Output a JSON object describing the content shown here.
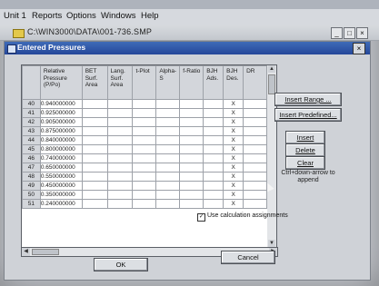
{
  "app": {
    "menu": [
      "Unit 1",
      "Reports",
      "Options",
      "Windows",
      "Help"
    ],
    "window_path": "C:\\WIN3000\\DATA\\001-736.SMP",
    "window_buttons": [
      "_",
      "□",
      "×"
    ]
  },
  "dialog": {
    "title": "Entered Pressures",
    "close_label": "×",
    "columns": [
      "Relative Pressure (P/Po)",
      "BET Surf. Area",
      "Lang. Surf. Area",
      "t-Plot",
      "Alpha-S",
      "f-Ratio",
      "BJH Ads.",
      "BJH Des.",
      "DR"
    ],
    "rows": [
      {
        "n": "40",
        "p": "0.940000000",
        "bjh_des": "X"
      },
      {
        "n": "41",
        "p": "0.925000000",
        "bjh_des": "X"
      },
      {
        "n": "42",
        "p": "0.905000000",
        "bjh_des": "X"
      },
      {
        "n": "43",
        "p": "0.875000000",
        "bjh_des": "X"
      },
      {
        "n": "44",
        "p": "0.840000000",
        "bjh_des": "X"
      },
      {
        "n": "45",
        "p": "0.800000000",
        "bjh_des": "X"
      },
      {
        "n": "46",
        "p": "0.740000000",
        "bjh_des": "X"
      },
      {
        "n": "47",
        "p": "0.650000000",
        "bjh_des": "X"
      },
      {
        "n": "48",
        "p": "0.550000000",
        "bjh_des": "X"
      },
      {
        "n": "49",
        "p": "0.450000000",
        "bjh_des": "X"
      },
      {
        "n": "50",
        "p": "0.350000000",
        "bjh_des": "X"
      },
      {
        "n": "51",
        "p": "0.240000000",
        "bjh_des": "X"
      }
    ],
    "buttons": {
      "insert_range": "Insert Range ...",
      "insert_predefined": "Insert Predefined...",
      "insert": "Insert",
      "delete": "Delete",
      "clear": "Clear",
      "ok": "OK",
      "cancel": "Cancel"
    },
    "hint": "Ctrl+down-arrow to append",
    "checkbox": {
      "label": "Use calculation assignments",
      "checked": true
    }
  }
}
